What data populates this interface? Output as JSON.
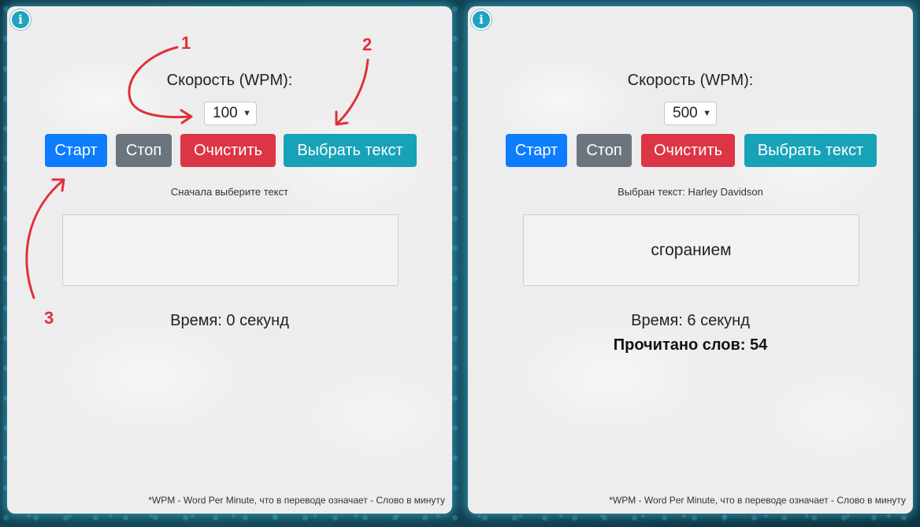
{
  "info_icon": "info-icon",
  "colors": {
    "start": "#0d7cff",
    "stop": "#6c757d",
    "clear": "#dc3545",
    "choose": "#17a2b8",
    "annotation": "#e0303a"
  },
  "left": {
    "speed_label": "Скорость (WPM):",
    "speed_value": "100",
    "buttons": {
      "start": "Старт",
      "stop": "Стоп",
      "clear": "Очистить",
      "choose": "Выбрать текст"
    },
    "status": "Сначала выберите текст",
    "word": "",
    "time": "Время: 0 секунд",
    "footnote": "*WPM - Word Per Minute, что в переводе означает - Слово в минуту"
  },
  "right": {
    "speed_label": "Скорость (WPM):",
    "speed_value": "500",
    "buttons": {
      "start": "Старт",
      "stop": "Стоп",
      "clear": "Очистить",
      "choose": "Выбрать текст"
    },
    "status": "Выбран текст: Harley Davidson",
    "word": "сгоранием",
    "time": "Время: 6 секунд",
    "words_read": "Прочитано слов: 54",
    "footnote": "*WPM - Word Per Minute, что в переводе означает - Слово в минуту"
  },
  "annotations": {
    "one": "1",
    "two": "2",
    "three": "3"
  }
}
